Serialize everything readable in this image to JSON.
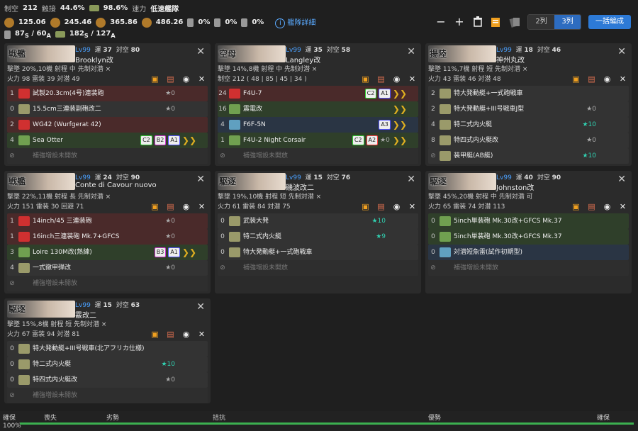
{
  "stats": {
    "row1": [
      {
        "label": "制空",
        "value": "212"
      },
      {
        "label": "触接",
        "value": "44.6%"
      },
      {
        "label": "",
        "value": "98.6%"
      },
      {
        "label": "速力",
        "value": "低速艦隊"
      }
    ],
    "row2": [
      "125.06",
      "245.46",
      "365.86",
      "486.26"
    ],
    "row2_pct": [
      "0%",
      "0%",
      "0%"
    ],
    "fleet_detail": "艦隊詳細",
    "row3": {
      "tp_s": "87",
      "tp_s_sub": "S",
      "tp_s_max": "60",
      "tp_s_max_sub": "A",
      "tp": "182",
      "tp_sub": "S",
      "tp_max": "127",
      "tp_max_sub": "A"
    }
  },
  "toolbar": {
    "minus": "−",
    "plus": "+",
    "col2": "2列",
    "col3": "3列",
    "bulk": "一括編成"
  },
  "ships": [
    {
      "banner": "戦艦",
      "lv": "Lv99",
      "luck_l": "運",
      "luck": "37",
      "aa_l": "対空",
      "aa": "80",
      "name": "Brooklyn改",
      "line_a": "撃墜 20%,10機 射程 中 先制対潜 ×",
      "line_b": "火力 98 雷装 39 対潜 49",
      "slots": [
        {
          "c": "red",
          "n": "1",
          "name": "試製20.3cm(4号)連装砲",
          "star": "★0",
          "tags": [],
          "chev": false
        },
        {
          "c": "gry",
          "n": "0",
          "name": "15.5cm三連装副砲改二",
          "star": "★0",
          "tags": [],
          "chev": false
        },
        {
          "c": "red",
          "n": "2",
          "name": "WG42 (Wurfgerat 42)",
          "star": "",
          "tags": [],
          "chev": false
        },
        {
          "c": "grn",
          "n": "4",
          "name": "Sea Otter",
          "star": "",
          "tags": [
            "C2",
            "B2",
            "A1"
          ],
          "chev": true
        },
        {
          "c": "dim",
          "n": "",
          "name": "補強増設未開放",
          "star": "",
          "tags": [],
          "chev": false
        }
      ]
    },
    {
      "banner": "空母",
      "lv": "Lv99",
      "luck_l": "運",
      "luck": "35",
      "aa_l": "対空",
      "aa": "58",
      "name": "Langley改",
      "line_a": "撃墜 14%,8機 射程 中 先制対潜 ×",
      "line_b": "制空 212 ( 48 | 85 | 45 | 34 )",
      "slots": [
        {
          "c": "red",
          "n": "24",
          "name": "F4U-7",
          "star": "",
          "tags": [
            "C2",
            "A1"
          ],
          "chev": true
        },
        {
          "c": "grn",
          "n": "16",
          "name": "震電改",
          "star": "",
          "tags": [],
          "chev": true
        },
        {
          "c": "blu",
          "n": "4",
          "name": "F6F-5N",
          "star": "",
          "tags": [
            "A3"
          ],
          "chev": true
        },
        {
          "c": "grn",
          "n": "1",
          "name": "F4U-2 Night Corsair",
          "star": "★0",
          "tags": [
            "C2",
            "A2"
          ],
          "chev": true
        },
        {
          "c": "dim",
          "n": "",
          "name": "補強増設未開放",
          "star": "",
          "tags": [],
          "chev": false
        }
      ]
    },
    {
      "banner": "揚陸",
      "lv": "Lv99",
      "luck_l": "運",
      "luck": "18",
      "aa_l": "対空",
      "aa": "46",
      "name": "神州丸改",
      "line_a": "撃墜 11%,7機 射程 短 先制対潜 ×",
      "line_b": "火力 43 雷装 46 対潜 48",
      "slots": [
        {
          "c": "gry",
          "n": "2",
          "name": "特大発動艇+一式砲戦車",
          "star": "",
          "tags": [],
          "chev": false
        },
        {
          "c": "gry",
          "n": "2",
          "name": "特大発動艇+III号戦車J型",
          "star": "★0",
          "tags": [],
          "chev": false
        },
        {
          "c": "gry",
          "n": "4",
          "name": "特二式内火艇",
          "star": "★10",
          "tags": [],
          "chev": false
        },
        {
          "c": "gry",
          "n": "8",
          "name": "特四式内火艇改",
          "star": "★0",
          "tags": [],
          "chev": false
        },
        {
          "c": "gry",
          "n": "",
          "name": "装甲艇(AB艇)",
          "star": "★10",
          "tags": [],
          "chev": false
        }
      ]
    },
    {
      "banner": "戦艦",
      "lv": "Lv99",
      "luck_l": "運",
      "luck": "24",
      "aa_l": "対空",
      "aa": "90",
      "name": "Conte di Cavour nuovo",
      "line_a": "撃墜 22%,11機 射程 長 先制対潜 ×",
      "line_b": "火力 151 雷装 30 回避 71",
      "slots": [
        {
          "c": "red",
          "n": "1",
          "name": "14inch/45 三連装砲",
          "star": "★0",
          "tags": [],
          "chev": false
        },
        {
          "c": "red",
          "n": "1",
          "name": "16inch三連装砲 Mk.7+GFCS",
          "star": "★0",
          "tags": [],
          "chev": false
        },
        {
          "c": "grn",
          "n": "3",
          "name": "Loire 130M改(熟練)",
          "star": "",
          "tags": [
            "B3",
            "A1"
          ],
          "chev": true
        },
        {
          "c": "gry",
          "n": "4",
          "name": "一式徹甲弾改",
          "star": "★0",
          "tags": [],
          "chev": false
        },
        {
          "c": "dim",
          "n": "",
          "name": "補強増設未開放",
          "star": "",
          "tags": [],
          "chev": false
        }
      ]
    },
    {
      "banner": "駆逐",
      "lv": "Lv99",
      "luck_l": "運",
      "luck": "15",
      "aa_l": "対空",
      "aa": "76",
      "name": "磯波改二",
      "line_a": "撃墜 19%,10機 射程 短 先制対潜 ×",
      "line_b": "火力 61 雷装 84 対潜 75",
      "slots": [
        {
          "c": "gry",
          "n": "0",
          "name": "武装大発",
          "star": "★10",
          "tags": [],
          "chev": false
        },
        {
          "c": "gry",
          "n": "0",
          "name": "特二式内火艇",
          "star": "★9",
          "tags": [],
          "chev": false
        },
        {
          "c": "gry",
          "n": "0",
          "name": "特大発動艇+一式砲戦車",
          "star": "",
          "tags": [],
          "chev": false
        },
        {
          "c": "dim",
          "n": "",
          "name": "補強増設未開放",
          "star": "",
          "tags": [],
          "chev": false
        }
      ]
    },
    {
      "banner": "駆逐",
      "lv": "Lv99",
      "luck_l": "運",
      "luck": "40",
      "aa_l": "対空",
      "aa": "90",
      "name": "Johnston改",
      "line_a": "撃墜 45%,20機 射程 中 先制対潜 可",
      "line_b": "火力 65 雷装 74 対潜 113",
      "slots": [
        {
          "c": "grn",
          "n": "0",
          "name": "5inch単装砲 Mk.30改+GFCS Mk.37",
          "star": "",
          "tags": [],
          "chev": false
        },
        {
          "c": "grn",
          "n": "0",
          "name": "5inch単装砲 Mk.30改+GFCS Mk.37",
          "star": "",
          "tags": [],
          "chev": false
        },
        {
          "c": "blu",
          "n": "0",
          "name": "対潜短魚雷(試作初期型)",
          "star": "",
          "tags": [],
          "chev": false
        },
        {
          "c": "dim",
          "n": "",
          "name": "補強増設未開放",
          "star": "",
          "tags": [],
          "chev": false
        }
      ]
    },
    {
      "banner": "駆逐",
      "lv": "Lv99",
      "luck_l": "運",
      "luck": "15",
      "aa_l": "対空",
      "aa": "63",
      "name": "霰改二",
      "line_a": "撃墜 15%,8機 射程 短 先制対潜 ×",
      "line_b": "火力 67 雷装 94 対潜 81",
      "slots": [
        {
          "c": "gry",
          "n": "0",
          "name": "特大発動艇+III号戦車(北アフリカ仕様)",
          "star": "",
          "tags": [],
          "chev": false
        },
        {
          "c": "gry",
          "n": "0",
          "name": "特二式内火艇",
          "star": "★10",
          "tags": [],
          "chev": false
        },
        {
          "c": "gry",
          "n": "0",
          "name": "特四式内火艇改",
          "star": "★0",
          "tags": [],
          "chev": false
        },
        {
          "c": "dim",
          "n": "",
          "name": "補強増設未開放",
          "star": "",
          "tags": [],
          "chev": false
        }
      ]
    }
  ],
  "bottom": {
    "labels": [
      "確保",
      "喪失",
      "劣勢",
      "拮抗",
      "優勢",
      "確保"
    ],
    "pct": "100%",
    "progress": 1.0
  }
}
